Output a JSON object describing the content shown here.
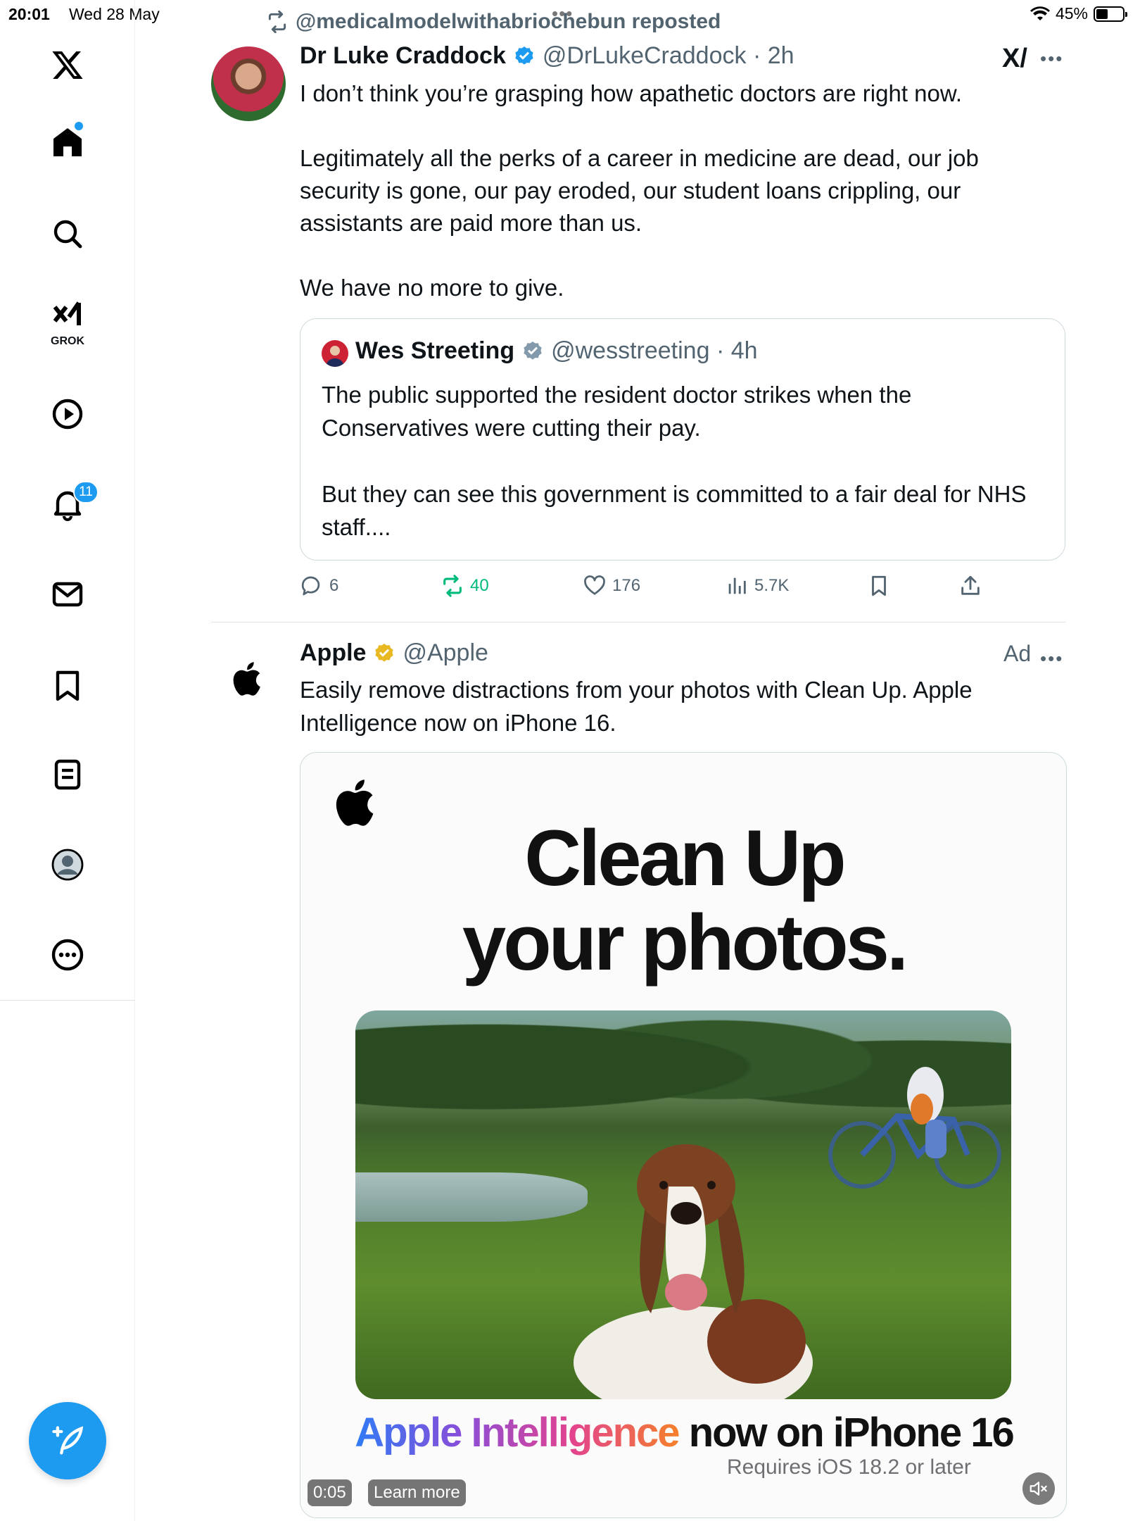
{
  "status_bar": {
    "time": "20:01",
    "date": "Wed 28 May",
    "battery": "45%",
    "battery_level": 0.45
  },
  "sidebar": {
    "grok_label": "GROK",
    "notifications_count": "11"
  },
  "tweet": {
    "reposted_by": "@medicalmodelwithabriochebun reposted",
    "author_name": "Dr Luke Craddock",
    "author_handle": "@DrLukeCraddock",
    "time": "2h",
    "text": "I don’t think you’re grasping how apathetic doctors are right now.\n\nLegitimately all the perks of a career in medicine are dead, our job security is gone, our pay eroded, our student loans crippling, our assistants are paid more than us.\n\nWe have no more to give.",
    "quote": {
      "author_name": "Wes Streeting",
      "author_handle": "@wesstreeting",
      "time": "4h",
      "text": "The public supported the resident doctor strikes when the Conservatives were cutting their pay.\n\nBut they can see this government is committed to a fair deal for NHS staff...."
    },
    "stats": {
      "replies": "6",
      "reposts": "40",
      "likes": "176",
      "views": "5.7K"
    }
  },
  "ad": {
    "author_name": "Apple",
    "author_handle": "@Apple",
    "ad_label": "Ad",
    "text": "Easily remove distractions from your photos with Clean Up. Apple Intelligence now on iPhone 16.",
    "media": {
      "headline": "Clean Up\nyour photos.",
      "tagline_ai": "Apple Intelligence",
      "tagline_rest": " now on iPhone 16",
      "requires": "Requires iOS 18.2 or later",
      "duration": "0:05",
      "cta": "Learn more"
    }
  },
  "colors": {
    "accent": "#1d9bf0",
    "repost_green": "#00ba7c",
    "muted": "#536471",
    "gold": "#e8b923"
  }
}
